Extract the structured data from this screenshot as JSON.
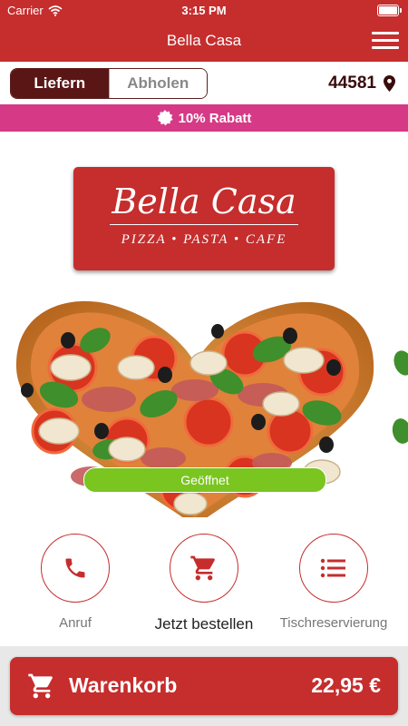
{
  "status_bar": {
    "carrier": "Carrier",
    "time": "3:15 PM"
  },
  "header": {
    "title": "Bella Casa"
  },
  "delivery_toggle": {
    "deliver_label": "Liefern",
    "pickup_label": "Abholen",
    "selected": "Liefern"
  },
  "location": {
    "zip": "44581",
    "icon": "location-pin-icon"
  },
  "discount_banner": {
    "text": "10% Rabatt",
    "icon": "badge-icon"
  },
  "logo": {
    "name": "Bella Casa",
    "tagline": "PIZZA • PASTA • CAFE"
  },
  "hero": {
    "status_label": "Geöffnet",
    "image": "heart-shaped-pizza"
  },
  "actions": [
    {
      "label": "Anruf",
      "icon": "phone-icon"
    },
    {
      "label": "Jetzt bestellen",
      "icon": "cart-icon"
    },
    {
      "label": "Tischreservierung",
      "icon": "list-icon"
    }
  ],
  "cart": {
    "label": "Warenkorb",
    "price": "22,95 €",
    "icon": "cart-icon"
  },
  "colors": {
    "brand_red": "#c62d2d",
    "dark_maroon": "#5a1515",
    "discount_pink": "#d63a86",
    "open_green": "#7ac520"
  }
}
